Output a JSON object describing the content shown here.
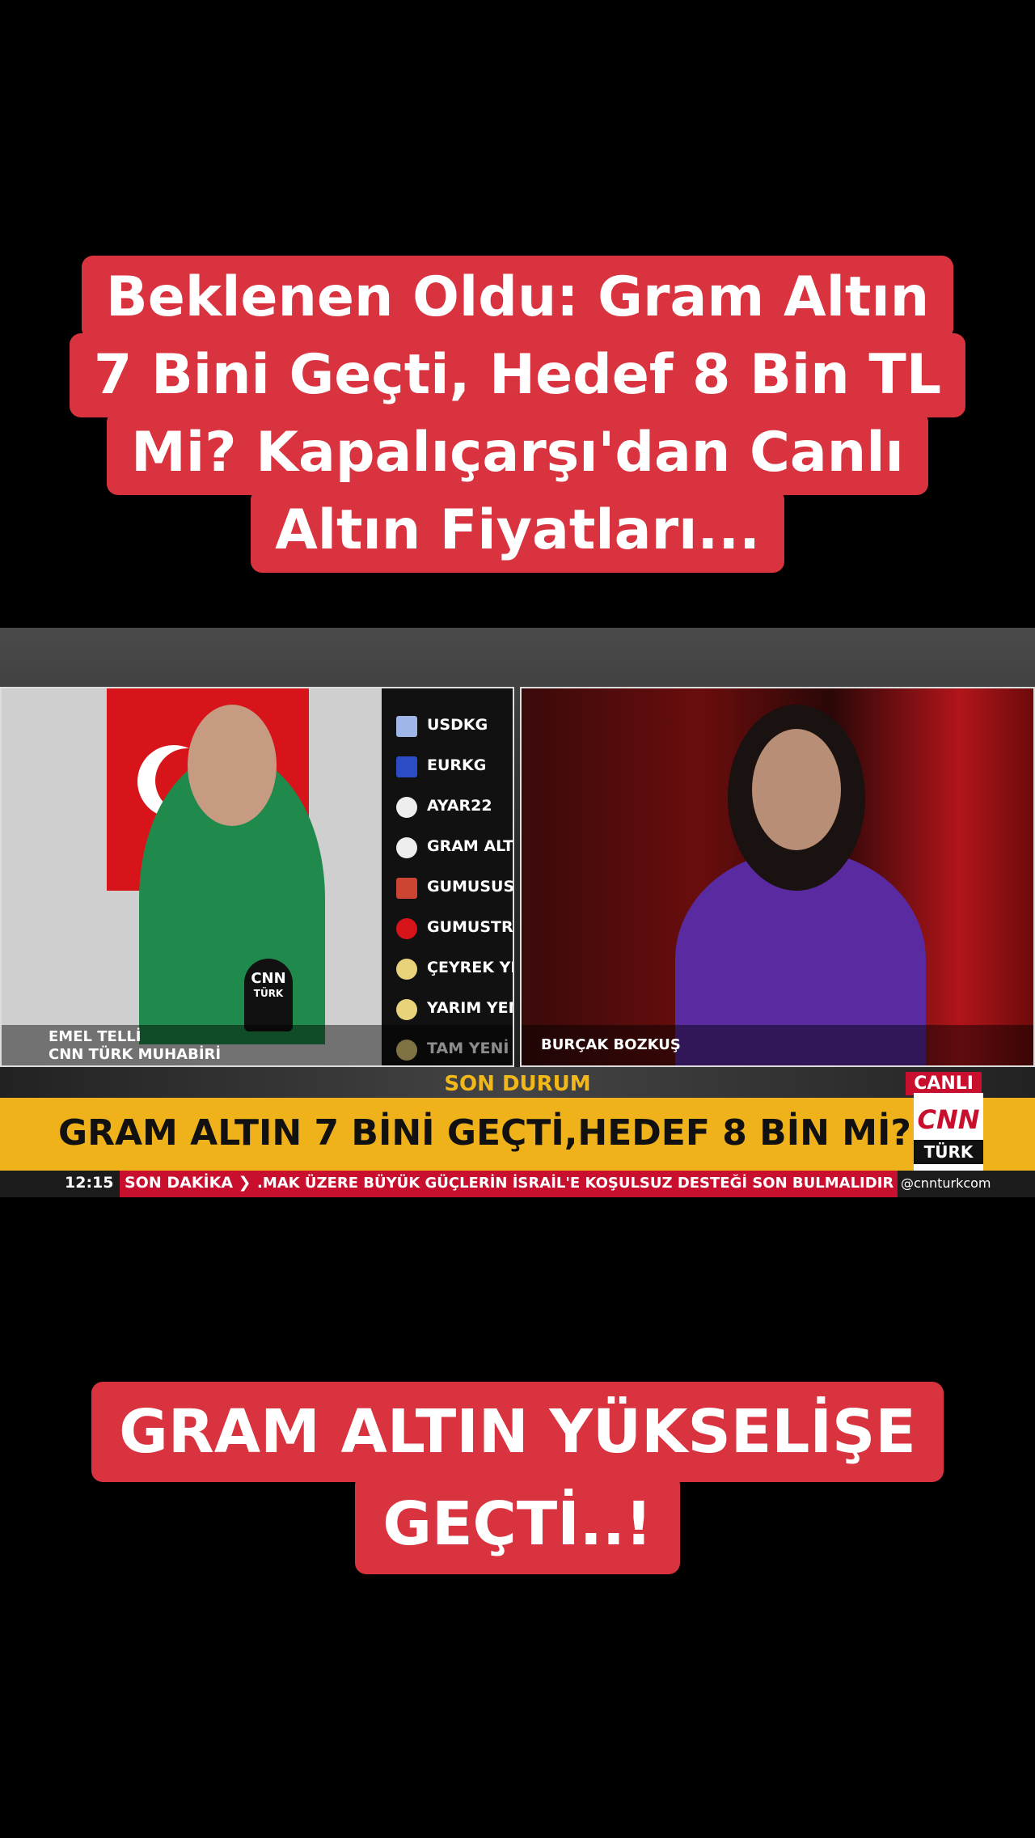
{
  "top_caption": {
    "lines": [
      "Beklenen Oldu: Gram Altın",
      "7 Bini Geçti, Hedef 8 Bin TL",
      "Mi? Kapalıçarşı'dan Canlı",
      "Altın Fiyatları..."
    ]
  },
  "broadcast": {
    "left_reporter": {
      "name": "EMEL TELLİ",
      "title": "CNN TÜRK MUHABİRİ",
      "mic_logo_top": "CNN",
      "mic_logo_bottom": "TÜRK"
    },
    "right_anchor": {
      "name": "BURÇAK BOZKUŞ"
    },
    "board_rows": [
      "USDKG",
      "EURKG",
      "AYAR22",
      "GRAM ALTI",
      "GUMUSUSD",
      "GUMUSTRY",
      "ÇEYREK YE",
      "YARIM YEN",
      "TAM YENİ"
    ],
    "son_durum": "SON DURUM",
    "canli": "CANLI",
    "headline": "GRAM ALTIN 7 BİNİ GEÇTİ,HEDEF 8 BİN Mİ?",
    "logo_top": "CNN",
    "logo_bottom": "TÜRK",
    "ticker": {
      "time": "12:15",
      "label": "SON DAKİKA ❯",
      "text": ".MAK ÜZERE BÜYÜK GÜÇLERİN İSRAİL'E KOŞULSUZ DESTEĞİ SON BULMALIDIR",
      "handle": "@cnnturkcom"
    }
  },
  "bottom_caption": {
    "lines": [
      "GRAM ALTIN YÜKSELİŞE",
      "GEÇTİ..!"
    ]
  },
  "colors": {
    "caption_bg": "#d9333f",
    "headline_bg": "#f0b21b",
    "brand_red": "#c8102e"
  }
}
